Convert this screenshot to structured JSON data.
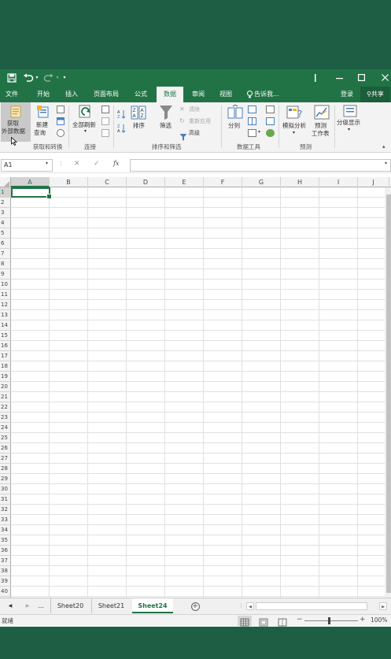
{
  "title_bar": {
    "save_icon": "save-icon",
    "undo_icon": "undo-icon",
    "redo_icon": "redo-icon",
    "customize_icon": "customize-quick-access-icon",
    "window_controls": [
      "minimize-icon",
      "maximize-icon",
      "close-icon"
    ]
  },
  "tabs": [
    {
      "label": "文件"
    },
    {
      "label": "开始"
    },
    {
      "label": "插入"
    },
    {
      "label": "页面布局"
    },
    {
      "label": "公式"
    },
    {
      "label": "数据",
      "active": true
    },
    {
      "label": "审阅"
    },
    {
      "label": "视图"
    },
    {
      "label": "告诉我..."
    }
  ],
  "account": {
    "signin": "登录",
    "share": "共享"
  },
  "ribbon": {
    "get_external_data": {
      "line1": "获取",
      "line2": "外部数据"
    },
    "new_query": {
      "line1": "新建",
      "line2": "查询"
    },
    "refresh_all": "全部刷新",
    "sort": "排序",
    "filter": "筛选",
    "clear": "清除",
    "reapply": "重新应用",
    "advanced": "高级",
    "text_to_columns": "分列",
    "what_if": "模拟分析",
    "forecast_sheet": {
      "line1": "预测",
      "line2": "工作表"
    },
    "outline": "分级显示",
    "groups": {
      "get_transform": "获取和转换",
      "connections": "连接",
      "sort_filter": "排序和筛选",
      "data_tools": "数据工具",
      "forecast": "预测"
    }
  },
  "formula_bar": {
    "name_box": "A1",
    "cancel": "✕",
    "enter": "✓",
    "fx": "fx",
    "value": ""
  },
  "columns": [
    "A",
    "B",
    "C",
    "D",
    "E",
    "F",
    "G",
    "H",
    "I",
    "J"
  ],
  "rows": [
    "1",
    "2",
    "3",
    "4",
    "5",
    "6",
    "7",
    "8",
    "9",
    "10",
    "11",
    "12",
    "13",
    "14",
    "15",
    "16",
    "17",
    "18",
    "19",
    "20",
    "21",
    "22",
    "23",
    "24",
    "25",
    "26",
    "27",
    "28",
    "29",
    "30",
    "31",
    "32",
    "33",
    "34",
    "35",
    "36",
    "37",
    "38",
    "39",
    "40"
  ],
  "sheet_tabs": {
    "nav_prev": "◀",
    "nav_next": "▶",
    "ellipsis": "...",
    "tabs": [
      "Sheet20",
      "Sheet21",
      "Sheet24"
    ],
    "active_tab": "Sheet24",
    "add": "+"
  },
  "status_bar": {
    "status": "就绪",
    "zoom": "100%",
    "zoom_minus": "−",
    "zoom_plus": "+"
  },
  "colors": {
    "accent": "#217346",
    "background": "#1e5e45"
  }
}
